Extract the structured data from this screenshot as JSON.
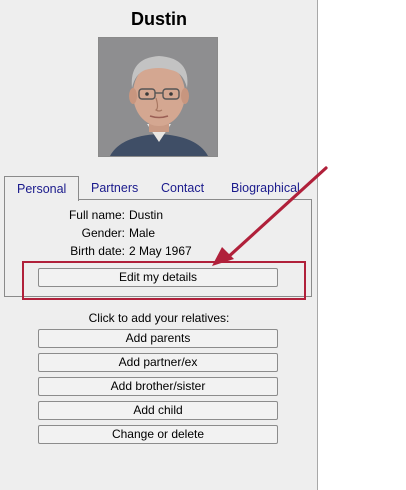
{
  "person": {
    "name": "Dustin",
    "details": [
      {
        "label": "Full name:",
        "value": "Dustin"
      },
      {
        "label": "Gender:",
        "value": "Male"
      },
      {
        "label": "Birth date:",
        "value": "2 May 1967"
      }
    ]
  },
  "tabs": [
    "Personal",
    "Partners",
    "Contact",
    "Biographical"
  ],
  "active_tab": "Personal",
  "edit_button": "Edit my details",
  "relatives_prompt": "Click to add your relatives:",
  "relative_buttons": [
    "Add parents",
    "Add partner/ex",
    "Add brother/sister",
    "Add child",
    "Change or delete"
  ],
  "colors": {
    "panel": "#eeeeee",
    "tab_text": "#1a1a8c",
    "annotation": "#b0203a"
  }
}
